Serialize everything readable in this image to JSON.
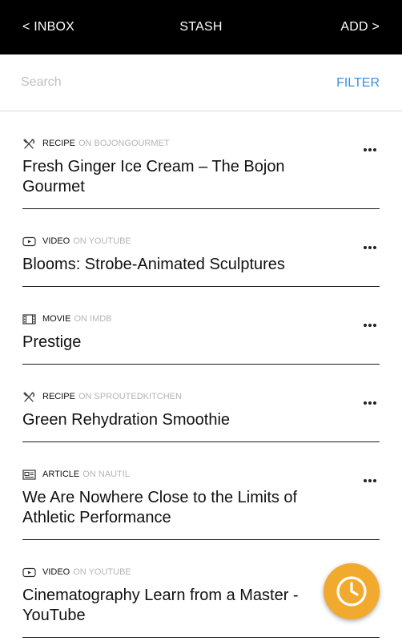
{
  "topbar": {
    "back_label": "< INBOX",
    "title": "STASH",
    "add_label": "ADD >"
  },
  "search": {
    "placeholder": "Search",
    "filter_label": "FILTER"
  },
  "items": [
    {
      "icon": "utensils-icon",
      "type": "RECIPE",
      "source": "ON BOJONGOURMET",
      "title": "Fresh Ginger Ice Cream – The Bojon Gourmet"
    },
    {
      "icon": "video-play-icon",
      "type": "VIDEO",
      "source": "ON YOUTUBE",
      "title": "Blooms: Strobe-Animated Sculptures"
    },
    {
      "icon": "film-strip-icon",
      "type": "MOVIE",
      "source": "ON IMDB",
      "title": "Prestige"
    },
    {
      "icon": "utensils-icon",
      "type": "RECIPE",
      "source": "ON SPROUTEDKITCHEN",
      "title": "Green Rehydration Smoothie"
    },
    {
      "icon": "newspaper-icon",
      "type": "ARTICLE",
      "source": "ON NAUTIL",
      "title": "We Are Nowhere Close to the Limits of Athletic Performance"
    },
    {
      "icon": "video-play-icon",
      "type": "VIDEO",
      "source": "ON YOUTUBE",
      "title": "Cinematography Learn from a Master - YouTube"
    }
  ],
  "fab": {
    "icon": "clock-icon"
  },
  "colors": {
    "topbar": "#000000",
    "filter": "#3d8fe0",
    "fab": "#f2aa2e",
    "source_text": "#b5b5b5"
  }
}
